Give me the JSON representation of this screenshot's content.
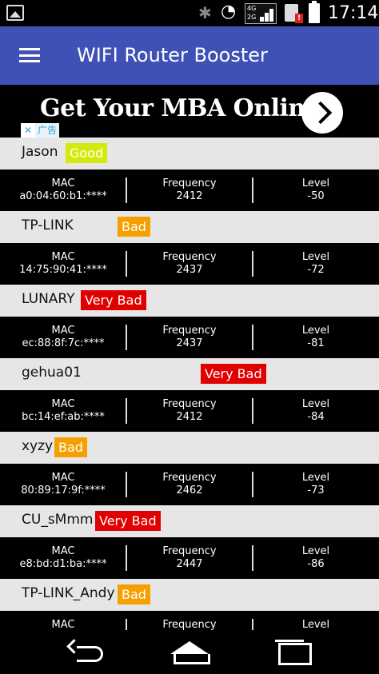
{
  "status_bar": {
    "time": "17:14",
    "network_type_top": "4G",
    "network_type_bottom": "2G"
  },
  "app_bar": {
    "title": "WIFI Router Booster"
  },
  "ad": {
    "headline": "Get Your MBA Online",
    "close_glyph": "✕",
    "label": "广告"
  },
  "colors": {
    "app_bar": "#3f51b5",
    "good": "#d4ea0c",
    "bad": "#f5a000",
    "very_bad": "#e00000"
  },
  "labels": {
    "mac": "MAC",
    "frequency": "Frequency",
    "level": "Level"
  },
  "networks": [
    {
      "ssid": "Jason",
      "quality": "Good",
      "mac": "a0:04:60:b1:****",
      "frequency": "2412",
      "level": "-50"
    },
    {
      "ssid": "TP-LINK",
      "quality": "Bad",
      "mac": "14:75:90:41:****",
      "frequency": "2437",
      "level": "-72"
    },
    {
      "ssid": "LUNARY",
      "quality": "Very Bad",
      "mac": "ec:88:8f:7c:****",
      "frequency": "2437",
      "level": "-81"
    },
    {
      "ssid": "gehua01",
      "quality": "Very Bad",
      "mac": "bc:14:ef:ab:****",
      "frequency": "2412",
      "level": "-84"
    },
    {
      "ssid": "xyzy",
      "quality": "Bad",
      "mac": "80:89:17:9f:****",
      "frequency": "2462",
      "level": "-73"
    },
    {
      "ssid": "CU_sMmm",
      "quality": "Very Bad",
      "mac": "e8:bd:d1:ba:****",
      "frequency": "2447",
      "level": "-86"
    },
    {
      "ssid": "TP-LINK_Andy",
      "quality": "Bad"
    }
  ]
}
